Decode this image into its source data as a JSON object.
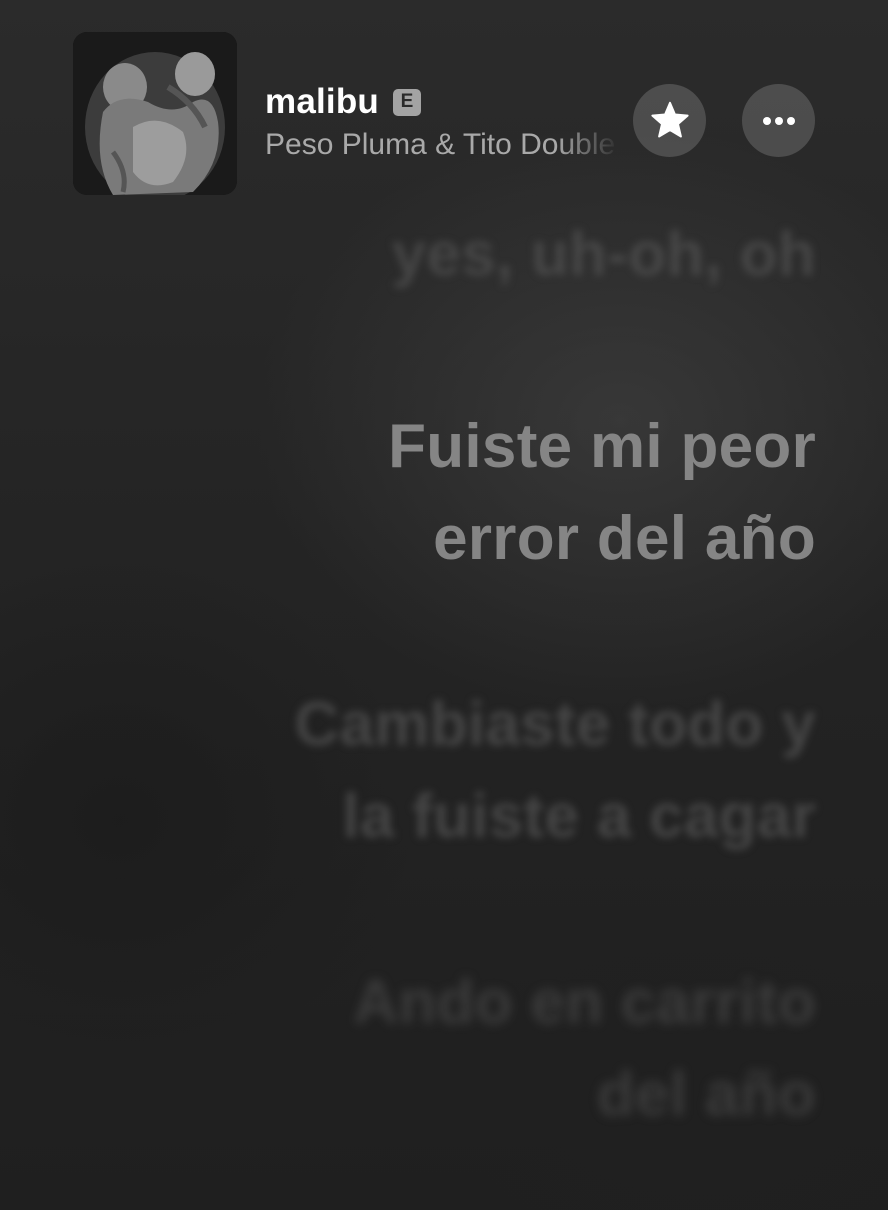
{
  "now_playing": {
    "title": "malibu",
    "explicit_badge": "E",
    "artist": "Peso Pluma & Tito Double P",
    "artwork_icon": "album-artwork"
  },
  "actions": {
    "favorite_icon": "star-icon",
    "more_icon": "ellipsis-icon"
  },
  "lyrics": {
    "previous": "yes, uh-oh, oh",
    "current": [
      "Fuiste mi peor",
      "error del año"
    ],
    "next": [
      "Cambiaste todo y",
      "la fuiste a cagar"
    ],
    "after": [
      "Ando en carrito",
      "del año"
    ]
  },
  "colors": {
    "background": "#262626",
    "title": "#ffffff",
    "artist": "#a9a9a9",
    "current_lyric": "#858585"
  }
}
